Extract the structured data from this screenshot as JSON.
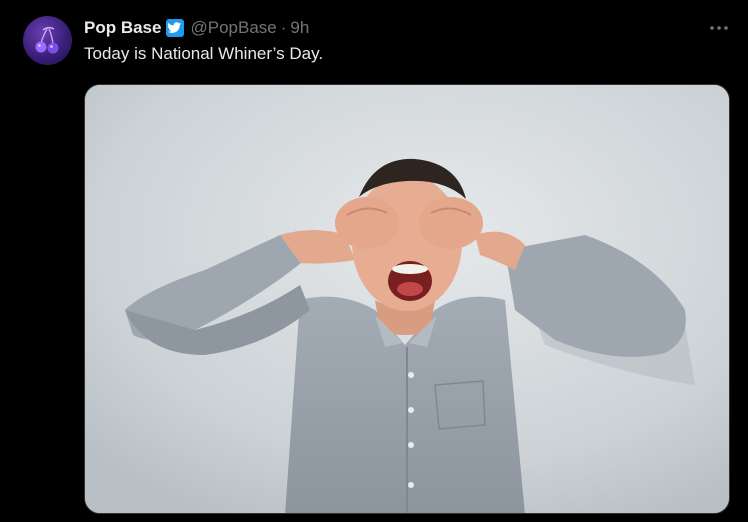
{
  "tweet": {
    "author_name": "Pop Base",
    "handle": "@PopBase",
    "separator": "·",
    "time": "9h",
    "text": "Today is National Whiner’s Day.",
    "more_icon": "more-horizontal-icon",
    "verified_icon": "verified-badge-icon"
  },
  "colors": {
    "background": "#000000",
    "name": "#e7e9ea",
    "secondary": "#71767b",
    "verified_bg": "#1d9bf0"
  }
}
